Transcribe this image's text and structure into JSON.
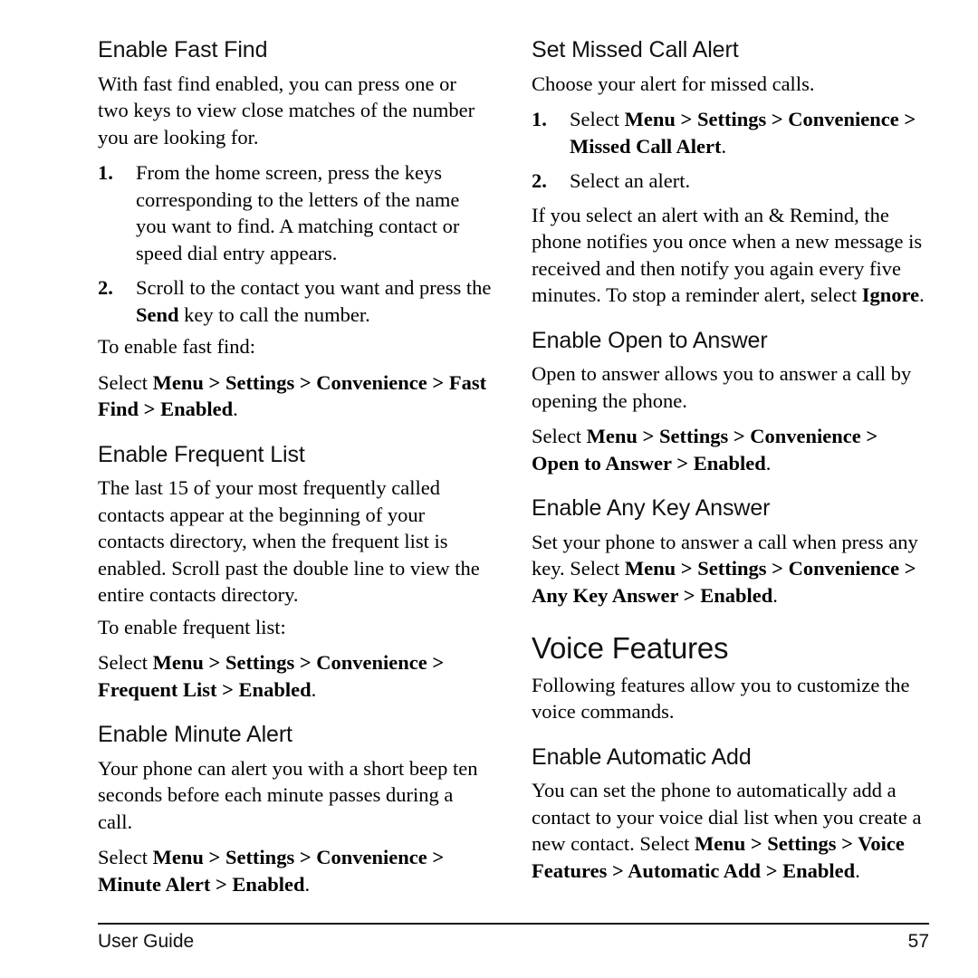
{
  "document": {
    "footer": {
      "label": "User Guide",
      "page_number": "57"
    }
  },
  "left_column": {
    "sections": [
      {
        "heading": "Enable Fast Find",
        "intro": "With fast find enabled, you can press one or two keys to view close matches of the number you are looking for.",
        "steps": [
          {
            "num": "1.",
            "text": "From the home screen, press the keys corresponding to the letters of the name you want to find. A matching contact or speed dial entry appears."
          },
          {
            "num": "2.",
            "text_before": "Scroll to the contact you want and press the ",
            "bold": "Send",
            "text_after": " key to call the number."
          }
        ],
        "lead_in": "To enable fast find:",
        "menu_path": {
          "select": "Select ",
          "items": [
            "Menu",
            "Settings",
            "Convenience",
            "Fast Find",
            "Enabled"
          ],
          "separator": " > ",
          "terminator": "."
        }
      },
      {
        "heading": "Enable Frequent List",
        "intro": "The last 15 of your most frequently called contacts appear at the beginning of your contacts directory, when the frequent list is enabled. Scroll past the double line to view the entire contacts directory.",
        "lead_in": "To enable frequent list:",
        "menu_path": {
          "select": "Select ",
          "items": [
            "Menu",
            "Settings",
            "Convenience",
            "Frequent List",
            "Enabled"
          ],
          "separator": " > ",
          "terminator": "."
        }
      },
      {
        "heading": "Enable Minute Alert",
        "intro": "Your phone can alert you with a short beep ten seconds before each minute passes during a call.",
        "menu_path": {
          "select": "Select ",
          "items": [
            "Menu",
            "Settings",
            "Convenience",
            "Minute Alert",
            "Enabled"
          ],
          "separator": " > ",
          "terminator": "."
        }
      }
    ]
  },
  "right_column": {
    "sections": [
      {
        "heading": "Set Missed Call Alert",
        "intro": "Choose your alert for missed calls.",
        "steps": [
          {
            "num": "1.",
            "select": "Select ",
            "items": [
              "Menu",
              "Settings",
              "Convenience",
              "Missed Call Alert"
            ],
            "separator": " > ",
            "terminator": "."
          },
          {
            "num": "2.",
            "text": "Select an alert."
          }
        ],
        "note_before": "If you select an alert with an & Remind, the phone notifies you once when a new message is received and then notify you again every five minutes. To stop a reminder alert, select ",
        "note_bold": "Ignore",
        "note_after": "."
      },
      {
        "heading": "Enable Open to Answer",
        "intro": "Open to answer allows you to answer a call by opening the phone.",
        "menu_path": {
          "select": "Select ",
          "items": [
            "Menu",
            "Settings",
            "Convenience",
            "Open to Answer",
            "Enabled"
          ],
          "separator": " > ",
          "terminator": "."
        }
      },
      {
        "heading": "Enable Any Key Answer",
        "intro_before": "Set your phone to answer a call when press any key. Select ",
        "intro_items": [
          "Menu",
          "Settings",
          "Convenience",
          "Any Key Answer",
          "Enabled"
        ],
        "separator": " > ",
        "terminator": "."
      }
    ],
    "chapter": {
      "title": "Voice Features",
      "intro": "Following features allow you to customize the voice commands.",
      "sections": [
        {
          "heading": "Enable Automatic Add",
          "intro_before": "You can set the phone to automatically add a contact to your voice dial list when you create a new contact. Select ",
          "intro_items": [
            "Menu",
            "Settings",
            "Voice Features",
            "Automatic Add",
            "Enabled"
          ],
          "separator": " > ",
          "terminator": "."
        }
      ]
    }
  }
}
